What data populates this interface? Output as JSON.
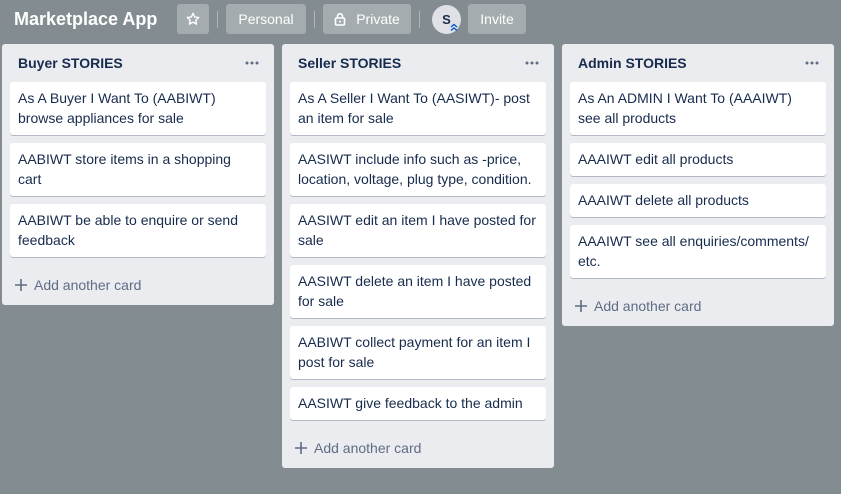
{
  "header": {
    "board_title": "Marketplace App",
    "personal_label": "Personal",
    "private_label": "Private",
    "avatar_initial": "S",
    "invite_label": "Invite"
  },
  "lists": [
    {
      "title": "Buyer STORIES",
      "cards": [
        "As A Buyer I Want To (AABIWT) browse appliances for sale",
        "AABIWT store items in a shopping cart",
        "AABIWT be able to enquire or send feedback"
      ],
      "add_label": "Add another card"
    },
    {
      "title": "Seller STORIES",
      "cards": [
        "As A Seller I Want To (AASIWT)- post an item for sale",
        "AASIWT include info such as -price, location, voltage, plug type, condition.",
        "AASIWT edit an item I have posted for sale",
        "AASIWT delete an item I have posted for sale",
        "AABIWT collect payment for an item I post for sale",
        "AASIWT give feedback to the admin"
      ],
      "add_label": "Add another card"
    },
    {
      "title": "Admin STORIES",
      "cards": [
        "As An ADMIN I Want To (AAAIWT) see all products",
        "AAAIWT edit all products",
        "AAAIWT delete all products",
        "AAAIWT see all enquiries/comments/ etc."
      ],
      "add_label": "Add another card"
    }
  ],
  "colors": {
    "board_background": "#838c91",
    "list_background": "#ebecf0",
    "card_background": "#ffffff"
  },
  "icons": [
    "star-icon",
    "lock-icon",
    "more-icon",
    "plus-icon"
  ]
}
